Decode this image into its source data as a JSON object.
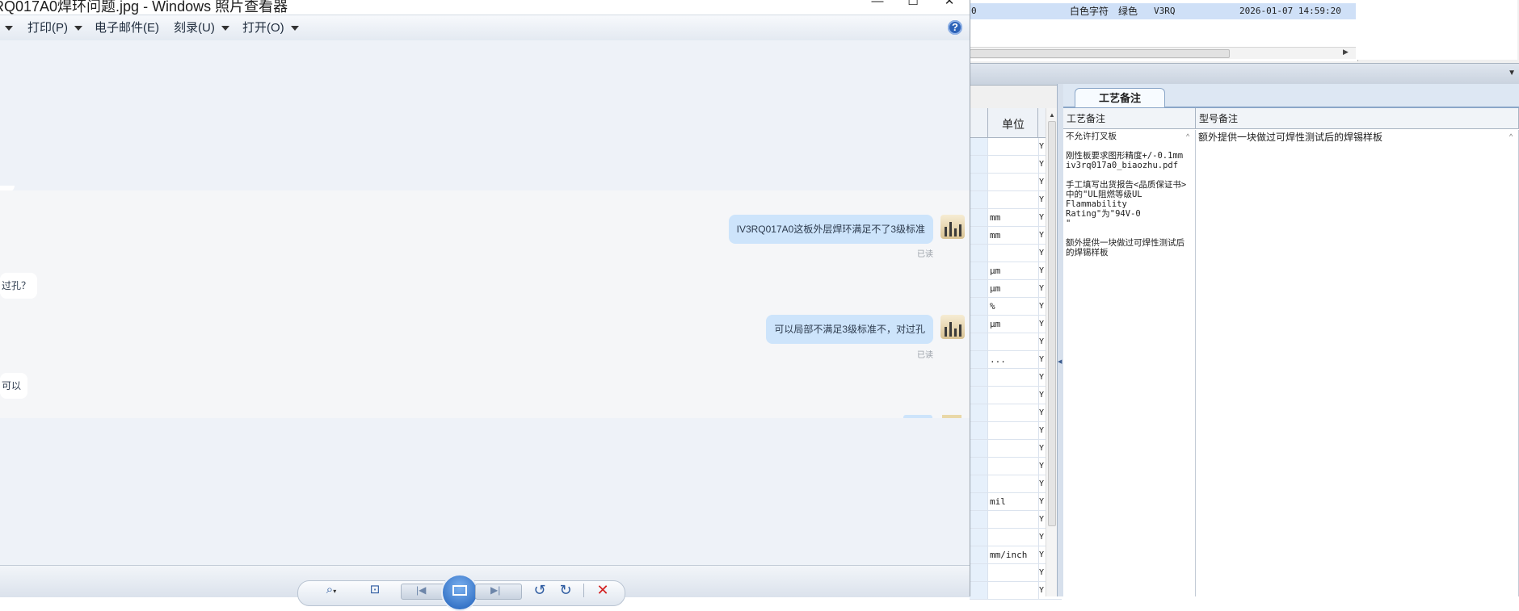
{
  "erp": {
    "top_row": {
      "left_cell": "0",
      "text_color": "白色字符",
      "color": "绿色",
      "code": "V3RQ",
      "datetime": "2026-01-07 14:59:20"
    },
    "grid": {
      "unit_header": "单位",
      "rows": [
        {
          "unit": "",
          "flag": "Y"
        },
        {
          "unit": "",
          "flag": "Y"
        },
        {
          "unit": "",
          "flag": "Y"
        },
        {
          "unit": "",
          "flag": "Y"
        },
        {
          "unit": "mm",
          "flag": "Y"
        },
        {
          "unit": "mm",
          "flag": "Y"
        },
        {
          "unit": "",
          "flag": "Y"
        },
        {
          "unit": "μm",
          "flag": "Y"
        },
        {
          "unit": "μm",
          "flag": "Y"
        },
        {
          "unit": "%",
          "flag": "Y"
        },
        {
          "unit": "μm",
          "flag": "Y"
        },
        {
          "unit": "",
          "flag": "Y"
        },
        {
          "unit": "...",
          "flag": "Y"
        },
        {
          "unit": "",
          "flag": "Y"
        },
        {
          "unit": "",
          "flag": "Y"
        },
        {
          "unit": "",
          "flag": "Y"
        },
        {
          "unit": "",
          "flag": "Y"
        },
        {
          "unit": "",
          "flag": "Y"
        },
        {
          "unit": "",
          "flag": "Y"
        },
        {
          "unit": "",
          "flag": "Y"
        },
        {
          "unit": "mil",
          "flag": "Y"
        },
        {
          "unit": "",
          "flag": "Y"
        },
        {
          "unit": "",
          "flag": "Y"
        },
        {
          "unit": "mm/inch",
          "flag": "Y"
        },
        {
          "unit": "",
          "flag": "Y"
        },
        {
          "unit": "",
          "flag": "Y"
        }
      ]
    },
    "tab_label": "工艺备注",
    "notes": {
      "col1_header": "工艺备注",
      "col2_header": "型号备注",
      "col1_text": "不允许打叉板\n\n刚性板要求图形精度+/-0.1mm\niv3rq017a0_biaozhu.pdf\n\n手工填写出货报告<品质保证书>\n中的\"UL阻燃等级UL\nFlammability Rating\"为\"94V-0\n\"\n\n额外提供一块做过可焊性测试后\n的焊锡样板",
      "col2_text": "额外提供一块做过可焊性测试后的焊锡样板"
    }
  },
  "viewer": {
    "title": "RQ017A0焊环问题.jpg - Windows 照片查看器",
    "window_buttons": {
      "minimize": "—",
      "maximize": "☐",
      "close": "✕"
    },
    "menu": {
      "print": "打印(P)",
      "email": "电子邮件(E)",
      "burn": "刻录(U)",
      "open": "打开(O)"
    },
    "help_glyph": "?",
    "messages": [
      {
        "side": "right",
        "text": "IV3RQ017A0这板外层焊环满足不了3级标准",
        "status": "已读"
      },
      {
        "side": "left",
        "text": "过孔？"
      },
      {
        "side": "right",
        "text": "可以局部不满足3级标准不，对过孔",
        "status": "已读"
      },
      {
        "side": "left",
        "text": "可以"
      }
    ],
    "toolbar": {
      "zoom": "zoom-icon",
      "fit": "fit-window-icon",
      "prev": "previous-icon",
      "slideshow": "slideshow-icon",
      "next": "next-icon",
      "rotate_left": "rotate-left-icon",
      "rotate_right": "rotate-right-icon",
      "delete": "delete-icon"
    }
  },
  "colors": {
    "bubble_right": "#cde4fb",
    "selection_row": "#cfe0f7",
    "delete_red": "#d21f1f",
    "accent_blue": "#2d63b8"
  }
}
